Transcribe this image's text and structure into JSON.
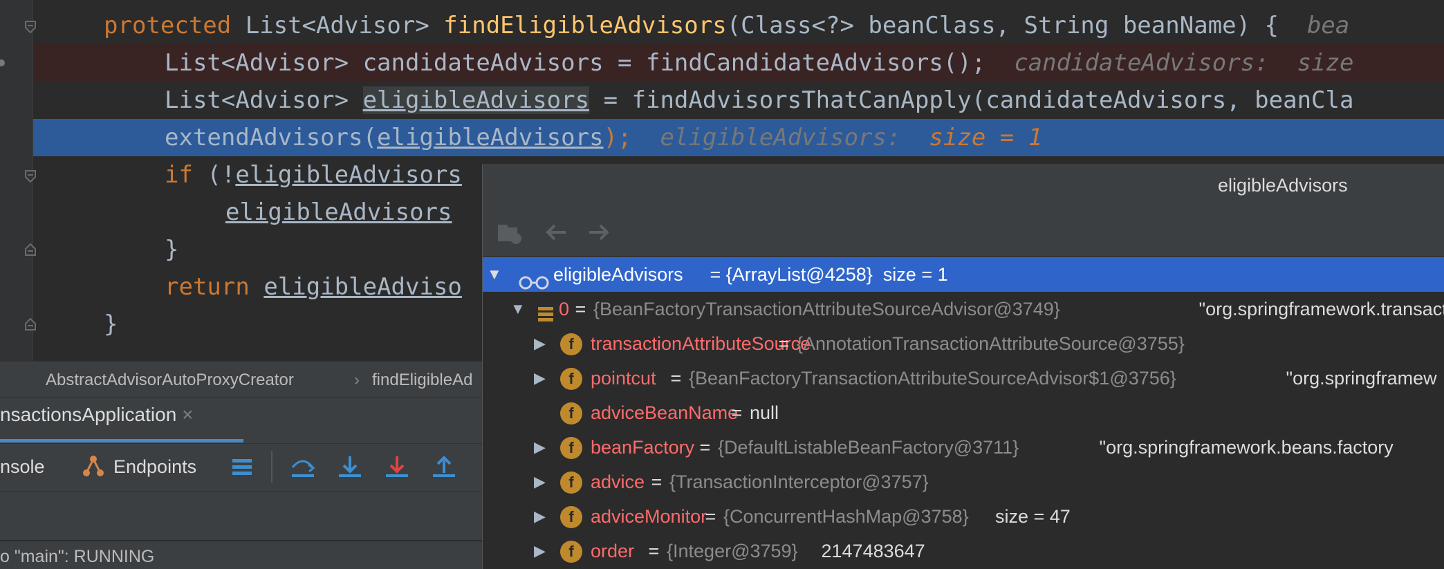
{
  "editor": {
    "lines": {
      "l1": {
        "kw": "protected",
        "pre": " List<Advisor> ",
        "fn": "findEligibleAdvisors",
        "post": "(Class<?> beanClass, String beanName) {  ",
        "hint": "bea"
      },
      "l2": {
        "text": "List<Advisor> candidateAdvisors = findCandidateAdvisors();",
        "hint_name": "candidateAdvisors:",
        "hint_val": "size"
      },
      "l3": {
        "pre": "List<Advisor> ",
        "var": "eligibleAdvisors",
        "post": " = findAdvisorsThatCanApply(candidateAdvisors, beanCla"
      },
      "l4": {
        "pre": "extendAdvisors(",
        "var": "eligibleAdvisors",
        "post": ");",
        "hint_name": "eligibleAdvisors:",
        "hint_val": "size = 1"
      },
      "l5": {
        "kw": "if",
        "pre": " (!",
        "var": "eligibleAdvisors"
      },
      "l6": {
        "var": "eligibleAdvisors"
      },
      "l7": {
        "text": "}"
      },
      "l8": {
        "kw": "return",
        "var": "eligibleAdviso"
      },
      "l9": {
        "text": "}"
      }
    },
    "colors": {
      "exec_highlight": "#2d5b9a",
      "breakpoint_line": "#3a2323",
      "background": "#2b2b2b"
    }
  },
  "breadcrumb": {
    "class": "AbstractAdvisorAutoProxyCreator",
    "sep": "›",
    "method": "findEligibleAd"
  },
  "run_tab": {
    "label": "nsactionsApplication",
    "close": "×"
  },
  "toolbar": {
    "console": "nsole",
    "endpoints": "Endpoints"
  },
  "status": {
    "text": "o \"main\": RUNNING"
  },
  "popup": {
    "title": "eligibleAdvisors",
    "tree": {
      "root": {
        "arrow": "▼",
        "name": "eligibleAdvisors",
        "rest": " = {ArrayList@4258}  size = 1"
      },
      "item0": {
        "arrow": "▼",
        "name": "0",
        "eq": " = ",
        "type": "{BeanFactoryTransactionAttributeSourceAdvisor@3749}",
        "str": " \"org.springframework.transactio"
      },
      "f1": {
        "arrow": "▶",
        "icon": "f",
        "name": "transactionAttributeSource",
        "eq": " = ",
        "type": "{AnnotationTransactionAttributeSource@3755}",
        "str": ""
      },
      "f2": {
        "arrow": "▶",
        "icon": "f",
        "name": "pointcut",
        "eq": " = ",
        "type": "{BeanFactoryTransactionAttributeSourceAdvisor$1@3756}",
        "str": " \"org.springframew"
      },
      "f3": {
        "arrow": "",
        "icon": "f",
        "name": "adviceBeanName",
        "eq": " = ",
        "type": "",
        "str": "null"
      },
      "f4": {
        "arrow": "▶",
        "icon": "f",
        "name": "beanFactory",
        "eq": " = ",
        "type": "{DefaultListableBeanFactory@3711}",
        "str": " \"org.springframework.beans.factory"
      },
      "f5": {
        "arrow": "▶",
        "icon": "f",
        "name": "advice",
        "eq": " = ",
        "type": "{TransactionInterceptor@3757}",
        "str": ""
      },
      "f6": {
        "arrow": "▶",
        "icon": "f",
        "name": "adviceMonitor",
        "eq": " = ",
        "type": "{ConcurrentHashMap@3758}",
        "str": "  size = 47"
      },
      "f7": {
        "arrow": "▶",
        "icon": "f",
        "name": "order",
        "eq": " = ",
        "type": "{Integer@3759}",
        "str": " 2147483647"
      }
    }
  }
}
